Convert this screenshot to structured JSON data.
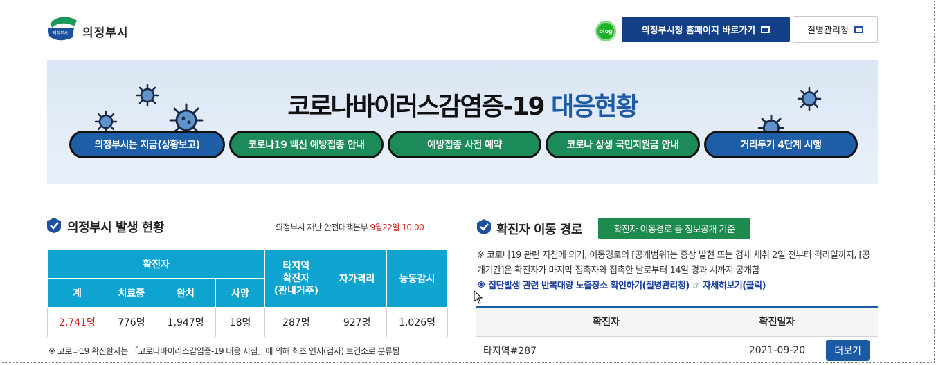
{
  "header": {
    "logo_text": "의정부시",
    "logo_badge": "의정부시",
    "blog_label": "blog",
    "home_button": "의정부시청 홈페이지 바로가기",
    "disease_button": "질병관리청"
  },
  "banner": {
    "title_main": "코로나바이러스감염증-19 ",
    "title_accent": "대응현황",
    "pills": [
      {
        "label": "의정부시는 지금(상황보고)",
        "color": "blue"
      },
      {
        "label": "코로나19 백신 예방접종 안내",
        "color": "green"
      },
      {
        "label": "예방접종 사전 예약",
        "color": "green"
      },
      {
        "label": "코로나 상생 국민지원금 안내",
        "color": "green"
      },
      {
        "label": "거리두기 4단계 시행",
        "color": "blue"
      }
    ]
  },
  "status": {
    "title": "의정부시 발생 현황",
    "source": "의정부시 재난 안전대책본부 ",
    "date": "9월22일 10:00",
    "headers": {
      "confirmed": "확진자",
      "total": "계",
      "treating": "치료중",
      "recovered": "완치",
      "deaths": "사망",
      "other_region": "타지역\n확진자\n(관내거주)",
      "self_quarantine": "자가격리",
      "active_monitoring": "능동감시"
    },
    "values": {
      "total": "2,741명",
      "treating": "776명",
      "recovered": "1,947명",
      "deaths": "18명",
      "other_region": "287명",
      "self_quarantine": "927명",
      "active_monitoring": "1,026명"
    },
    "note": "※ 코로나19 확진환자는 「코로나바이러스감염증-19 대응 지침」에 의해 최초 인지(검사) 보건소로 분류됨"
  },
  "movement": {
    "title": "확진자 이동 경로",
    "badge": "확진자 이동경로 등 정보공개 기준",
    "note": "※ 코로나19 관련 지침에 의거, 이동경로의 [공개범위]는 증상 발현 또는 검체 채취 2일 전부터 격리일까지, [공개기간]은 확진자가 마지막 접촉자와 접촉한 날로부터 14일 경과 시까지 공개함",
    "link": "※ 집단발생 관련 반복대량 노출장소 확인하기(질병관리청) ☞ 자세히보기(클릭)",
    "columns": [
      "확진자",
      "확진일자",
      ""
    ],
    "rows": [
      {
        "patient": "타지역#287",
        "date": "2021-09-20",
        "action": "더보기"
      }
    ]
  },
  "colors": {
    "navy": "#123f86",
    "teal_header": "#0fa3cf",
    "green": "#1d8a4e",
    "red": "#cc1a1a"
  }
}
